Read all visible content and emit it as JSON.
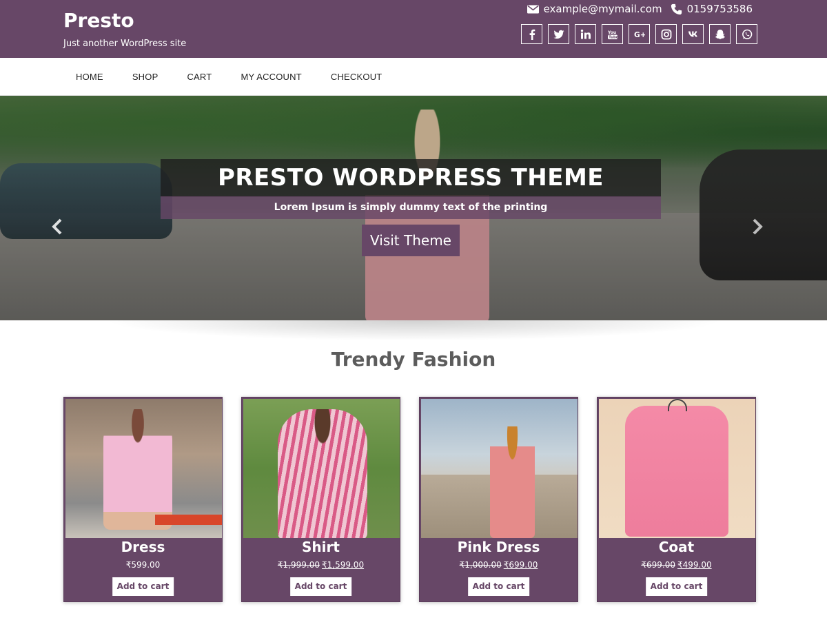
{
  "header": {
    "site_title": "Presto",
    "tagline": "Just another WordPress site",
    "email": "example@mymail.com",
    "phone": "0159753586",
    "social_icons": [
      "facebook-icon",
      "twitter-icon",
      "linkedin-icon",
      "youtube-icon",
      "google-plus-icon",
      "instagram-icon",
      "vk-icon",
      "snapchat-icon",
      "whatsapp-icon"
    ],
    "brand_color": "#674767"
  },
  "nav": {
    "items": [
      "HOME",
      "SHOP",
      "CART",
      "MY ACCOUNT",
      "CHECKOUT"
    ]
  },
  "hero": {
    "title": "PRESTO WORDPRESS THEME",
    "subtitle": "Lorem Ipsum is simply dummy text of the printing",
    "button": "Visit Theme"
  },
  "section": {
    "title": "Trendy Fashion"
  },
  "products": [
    {
      "name": "Dress",
      "price_old": "",
      "price": "₹599.00",
      "button": "Add to cart"
    },
    {
      "name": "Shirt",
      "price_old": "₹1,999.00",
      "price": "₹1,599.00",
      "button": "Add to cart"
    },
    {
      "name": "Pink Dress",
      "price_old": "₹1,000.00",
      "price": "₹699.00",
      "button": "Add to cart"
    },
    {
      "name": "Coat",
      "price_old": "₹699.00",
      "price": "₹499.00",
      "button": "Add to cart"
    }
  ]
}
